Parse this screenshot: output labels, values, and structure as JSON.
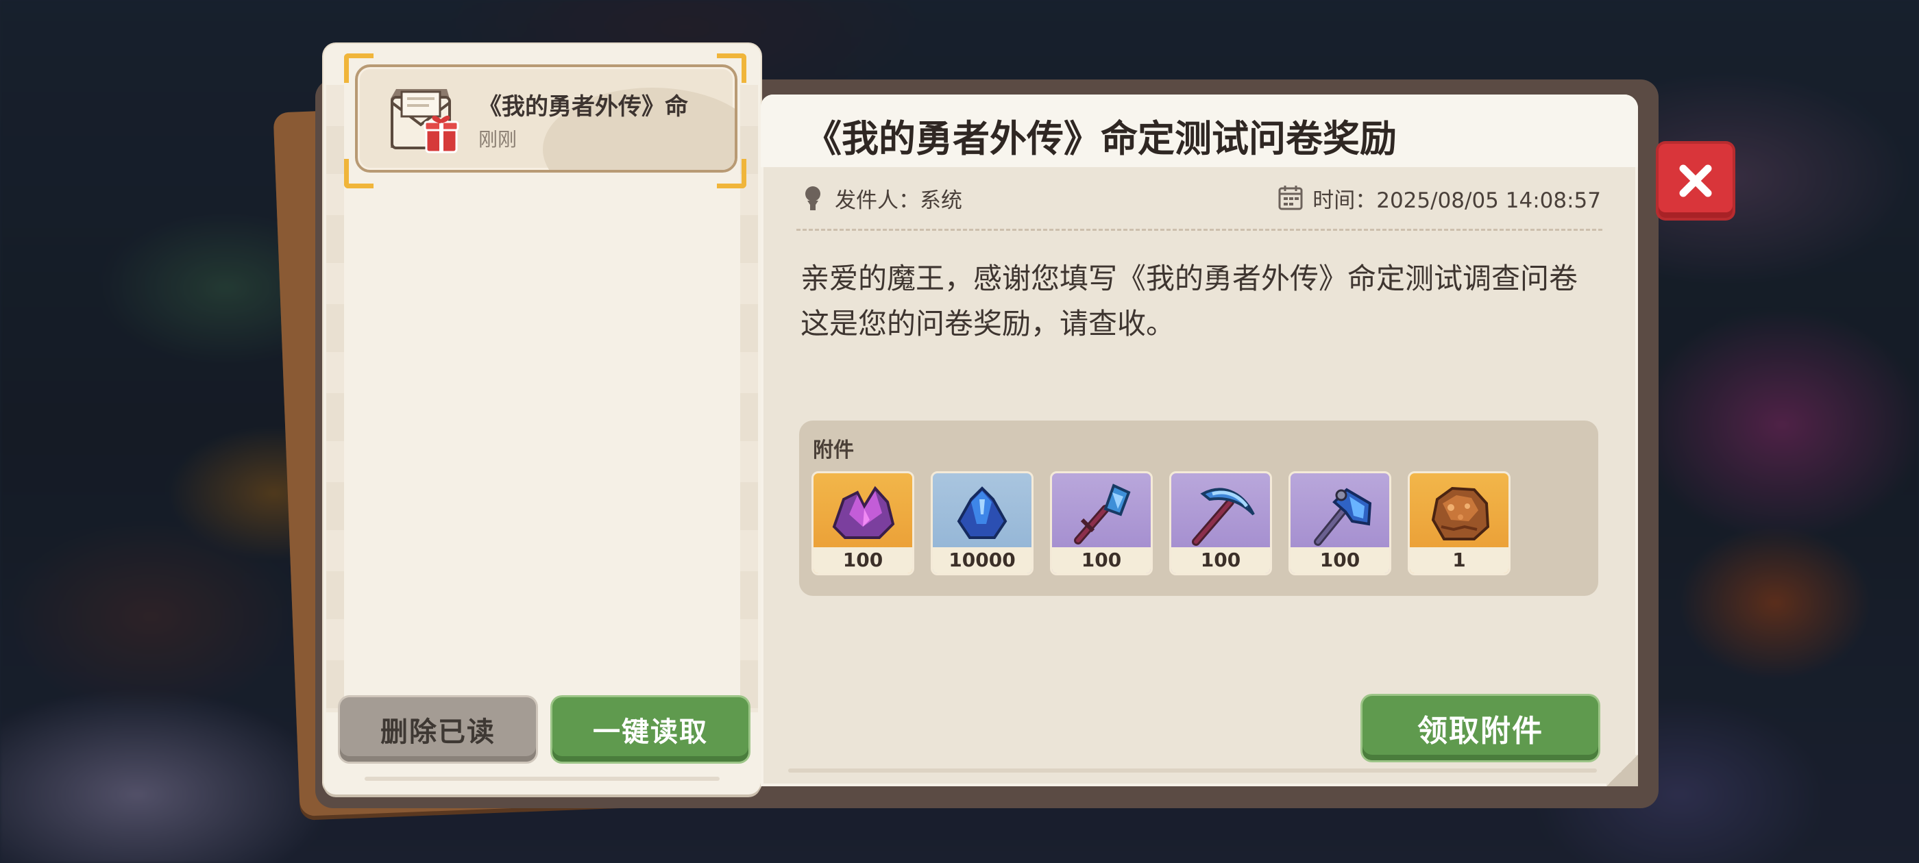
{
  "mail_list": {
    "items": [
      {
        "title": "《我的勇者外传》命",
        "time": "刚刚",
        "icon": "mail-gift-icon"
      }
    ],
    "buttons": {
      "delete_read": "删除已读",
      "read_all": "一键读取"
    }
  },
  "detail": {
    "title": "《我的勇者外传》命定测试问卷奖励",
    "sender": "发件人：系统",
    "time": "时间：2025/08/05 14:08:57",
    "body": "亲爱的魔王，感谢您填写《我的勇者外传》命定测试调查问卷\n这是您的问卷奖励，请查收。",
    "attachments_label": "附件",
    "attachments": [
      {
        "icon": "purple-crystal-icon",
        "quantity": "100",
        "rarity_color": "#eea43a"
      },
      {
        "icon": "blue-gem-icon",
        "quantity": "10000",
        "rarity_color": "#9ebcdb"
      },
      {
        "icon": "shovel-icon",
        "quantity": "100",
        "rarity_color": "#ad98d4"
      },
      {
        "icon": "pickaxe-icon",
        "quantity": "100",
        "rarity_color": "#ad98d4"
      },
      {
        "icon": "axe-icon",
        "quantity": "100",
        "rarity_color": "#ad98d4"
      },
      {
        "icon": "ore-chunk-icon",
        "quantity": "1",
        "rarity_color": "#eea43a"
      }
    ],
    "claim_button": "领取附件"
  },
  "colors": {
    "green_button": "#5f9a4e",
    "gray_button": "#a49c94",
    "close_red": "#d9353a",
    "highlight_gold": "#f0b53a"
  }
}
